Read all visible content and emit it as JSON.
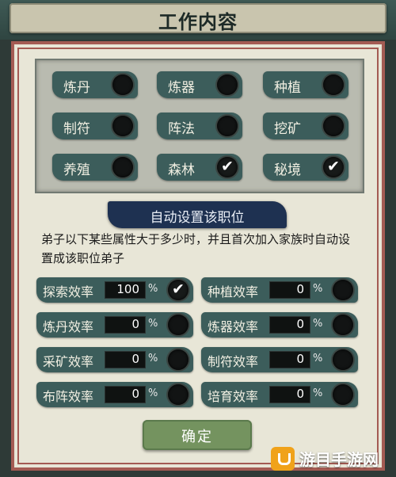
{
  "header": {
    "title": "工作内容"
  },
  "jobs": [
    {
      "label": "炼丹",
      "checked": false
    },
    {
      "label": "炼器",
      "checked": false
    },
    {
      "label": "种植",
      "checked": false
    },
    {
      "label": "制符",
      "checked": false
    },
    {
      "label": "阵法",
      "checked": false
    },
    {
      "label": "挖矿",
      "checked": false
    },
    {
      "label": "养殖",
      "checked": false
    },
    {
      "label": "森林",
      "checked": true
    },
    {
      "label": "秘境",
      "checked": true
    }
  ],
  "auto_set": {
    "title": "自动设置该职位",
    "description": "弟子以下某些属性大于多少时，并且首次加入家族时自动设置成该职位弟子"
  },
  "stats": [
    {
      "label": "探索效率",
      "value": "100",
      "unit": "%",
      "checked": true
    },
    {
      "label": "种植效率",
      "value": "0",
      "unit": "%",
      "checked": false
    },
    {
      "label": "炼丹效率",
      "value": "0",
      "unit": "%",
      "checked": false
    },
    {
      "label": "炼器效率",
      "value": "0",
      "unit": "%",
      "checked": false
    },
    {
      "label": "采矿效率",
      "value": "0",
      "unit": "%",
      "checked": false
    },
    {
      "label": "制符效率",
      "value": "0",
      "unit": "%",
      "checked": false
    },
    {
      "label": "布阵效率",
      "value": "0",
      "unit": "%",
      "checked": false
    },
    {
      "label": "培育效率",
      "value": "0",
      "unit": "%",
      "checked": false
    }
  ],
  "check_mark": "✔",
  "confirm": {
    "label": "确定"
  },
  "watermark": {
    "text": "游目手游网",
    "icon": "logo-icon"
  }
}
